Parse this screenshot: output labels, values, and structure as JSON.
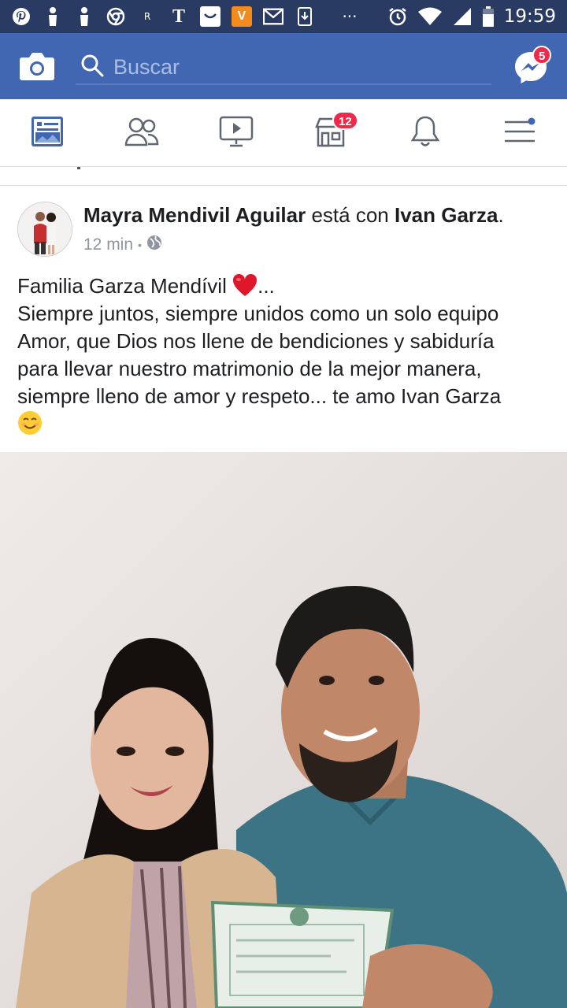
{
  "status_bar": {
    "time": "19:59",
    "left_icons": [
      "pinterest-icon",
      "person-icon",
      "person-icon",
      "chrome-icon",
      "r-icon",
      "t-icon",
      "app-icon",
      "v-icon",
      "mail-icon",
      "download-icon",
      "more-icon"
    ],
    "v_label": "V",
    "r_label": "R",
    "t_label": "T",
    "dots_label": "···"
  },
  "top_bar": {
    "search_placeholder": "Buscar",
    "messenger_badge": "5"
  },
  "tabs": [
    {
      "name": "news-feed",
      "icon": "news-feed-icon",
      "active": true
    },
    {
      "name": "friends",
      "icon": "friends-icon"
    },
    {
      "name": "watch",
      "icon": "watch-icon"
    },
    {
      "name": "marketplace",
      "icon": "marketplace-icon",
      "badge": "12"
    },
    {
      "name": "notifications",
      "icon": "bell-icon"
    },
    {
      "name": "menu",
      "icon": "menu-icon"
    }
  ],
  "post": {
    "author": "Mayra Mendivil Aguilar",
    "with_text": "está con",
    "tagged": "Ivan Garza",
    "period": ".",
    "time": "12 min",
    "dot": "•",
    "lines": [
      "Familia Garza Mendívil",
      "Siempre juntos, siempre unidos como un solo equipo",
      "Amor, que Dios nos llene de bendiciones y sabiduría",
      "para llevar nuestro matrimonio de la mejor manera,",
      "siempre lleno de amor y respeto... te amo Ivan Garza"
    ],
    "ellipsis": "..."
  },
  "colors": {
    "status_bar": "#293a63",
    "top_bar": "#4267b2",
    "accent": "#4267b2",
    "badge": "#f02849",
    "text": "#1c1e21",
    "meta": "#90949c"
  }
}
